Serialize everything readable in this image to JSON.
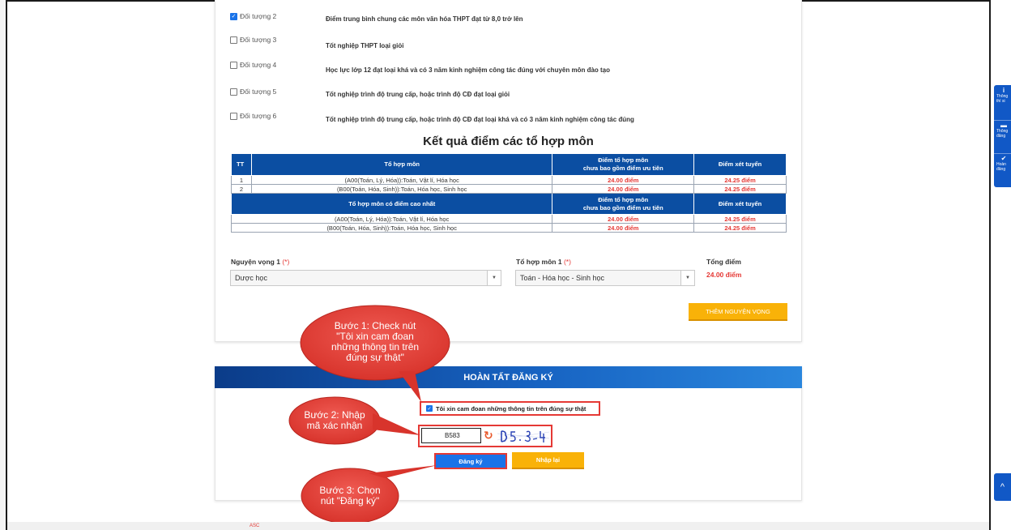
{
  "objectives": [
    {
      "label": "Đối tượng 2",
      "checked": true,
      "desc": "Điểm trung bình chung các môn văn hóa THPT đạt từ 8,0 trở lên"
    },
    {
      "label": "Đối tượng 3",
      "checked": false,
      "desc": "Tốt nghiệp THPT loại giỏi"
    },
    {
      "label": "Đối tượng 4",
      "checked": false,
      "desc": "Học lực lớp 12 đạt loại khá và có 3 năm kinh nghiệm công tác đúng với chuyên môn đào tạo"
    },
    {
      "label": "Đối tượng 5",
      "checked": false,
      "desc": "Tốt nghiệp trình độ trung cấp, hoặc trình độ CĐ đạt loại giỏi"
    },
    {
      "label": "Đối tượng 6",
      "checked": false,
      "desc": "Tốt nghiệp trình độ trung cấp, hoặc trình độ CĐ đạt loại khá và có 3 năm kinh nghiệm công tác đúng"
    }
  ],
  "results": {
    "title": "Kết quả điểm các tổ hợp môn",
    "headers": {
      "tt": "TT",
      "combo": "Tổ hợp môn",
      "score_line1": "Điểm tổ hợp môn",
      "score_line2": "chưa bao gồm điểm ưu tiên",
      "admission": "Điểm xét tuyển",
      "best_combo": "Tổ hợp môn có điểm cao nhất"
    },
    "rows": [
      {
        "tt": "1",
        "combo": "(A00(Toán, Lý, Hóa)):Toán, Vật lí, Hóa học",
        "score": "24.00 điểm",
        "admission": "24.25 điểm"
      },
      {
        "tt": "2",
        "combo": "(B00(Toán, Hóa, Sinh)):Toán, Hóa học, Sinh học",
        "score": "24.00 điểm",
        "admission": "24.25 điểm"
      }
    ],
    "best_rows": [
      {
        "combo": "(A00(Toán, Lý, Hóa)):Toán, Vật lí, Hóa học",
        "score": "24.00 điểm",
        "admission": "24.25 điểm"
      },
      {
        "combo": "(B00(Toán, Hóa, Sinh)):Toán, Hóa học, Sinh học",
        "score": "24.00 điểm",
        "admission": "24.25 điểm"
      }
    ]
  },
  "selection": {
    "wish_label": "Nguyện vọng 1",
    "combo_label": "Tổ hợp môn 1",
    "required_mark": "(*)",
    "total_label": "Tổng điểm",
    "wish_value": "Dược học",
    "combo_value": "Toán - Hóa học - Sinh học",
    "total_value": "24.00 điểm",
    "add_button": "THÊM NGUYỆN VỌNG"
  },
  "complete": {
    "header": "HOÀN TẤT ĐĂNG KÝ",
    "agree_label": "Tôi xin cam đoan những thông tin trên đúng sự thật",
    "captcha_value": "B583",
    "register_button": "Đăng ký",
    "reset_button": "Nhập lại"
  },
  "callouts": {
    "step1": [
      "Bước 1: Check nút",
      "\"Tôi xin cam đoan",
      "những thông tin trên",
      "đúng sự thật\""
    ],
    "step2": [
      "Bước 2: Nhập",
      "mã xác nhận"
    ],
    "step3": [
      "Bước 3: Chọn",
      "nút \"Đăng ký\""
    ]
  },
  "side_panel": [
    {
      "icon": "i",
      "line1": "Thông",
      "line2": "thí si"
    },
    {
      "icon": "▬",
      "line1": "Thông",
      "line2": "đăng"
    },
    {
      "icon": "✔",
      "line1": "Hoàn",
      "line2": "đăng"
    }
  ],
  "footer_text": "ASC",
  "colors": {
    "primary": "#0b4ea2",
    "accent": "#f9b208",
    "callout": "#e53935",
    "score": "#e53935"
  }
}
